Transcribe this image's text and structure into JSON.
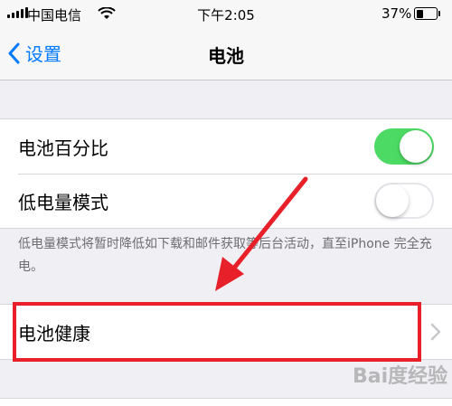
{
  "status_bar": {
    "carrier": "中国电信",
    "time": "下午2:05",
    "battery_percent": "37%",
    "battery_level": 0.37
  },
  "nav": {
    "back_label": "设置",
    "title": "电池"
  },
  "settings": {
    "battery_percentage": {
      "label": "电池百分比",
      "state": "on"
    },
    "low_power_mode": {
      "label": "低电量模式",
      "state": "off"
    },
    "low_power_note": "低电量模式将暂时降低如下载和邮件获取等后台活动，直至iPhone 完全充电。",
    "battery_health": {
      "label": "电池健康"
    }
  },
  "watermark": "Bai度经验",
  "colors": {
    "ios_blue": "#007aff",
    "toggle_green": "#4cd964",
    "annotation_red": "#e8202a"
  }
}
